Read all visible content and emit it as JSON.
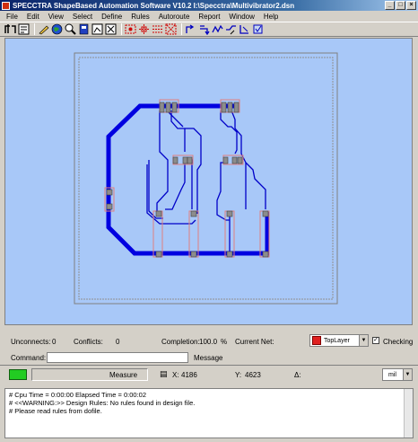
{
  "window": {
    "title": "SPECCTRA ShapeBased Automation Software V10.2 I:\\Specctra\\Multivibrator2.dsn",
    "controls": {
      "minimize": "_",
      "maximize": "□",
      "close": "×"
    }
  },
  "menu": [
    "File",
    "Edit",
    "View",
    "Select",
    "Define",
    "Rules",
    "Autoroute",
    "Report",
    "Window",
    "Help"
  ],
  "toolbar_icons": [
    "route-icon",
    "setup-icon",
    "pencil-icon",
    "globe-icon",
    "zoom-icon",
    "layers-icon",
    "window-icon",
    "edit-icon",
    "select-rect-icon",
    "fanout-icon",
    "connect-icon",
    "move-icon",
    "rotate-icon",
    "push-icon",
    "wire-icon",
    "via-icon",
    "spread-icon",
    "check-icon",
    "component-icon"
  ],
  "colors": {
    "canvas_bg": "#a8c8f8",
    "trace_wide": "#0000e0",
    "trace_thin": "#0000c8",
    "pad": "#8c8c8c",
    "outline": "#e08080",
    "boundary": "#909090"
  },
  "status": {
    "unconnects_label": "Unconnects:",
    "unconnects_value": "0",
    "conflicts_label": "Conflicts:",
    "conflicts_value": "0",
    "completion_label": "Completion:",
    "completion_value": "100.0",
    "completion_unit": "%",
    "current_net_label": "Current Net:",
    "layer": "TopLayer",
    "checking_label": "Checking",
    "command_label": "Command:",
    "message_label": "Message:",
    "mode": "Measure",
    "x_label": "X:",
    "x_value": "4186",
    "y_label": "Y:",
    "y_value": "4623",
    "delta_label": "Δ:",
    "units": "mil"
  },
  "console": [
    "# Cpu Time = 0:00:00  Elapsed Time = 0:00:02",
    "# <<WARNING:>> Design Rules: No rules found in design file.",
    "# Please read rules from dofile."
  ]
}
